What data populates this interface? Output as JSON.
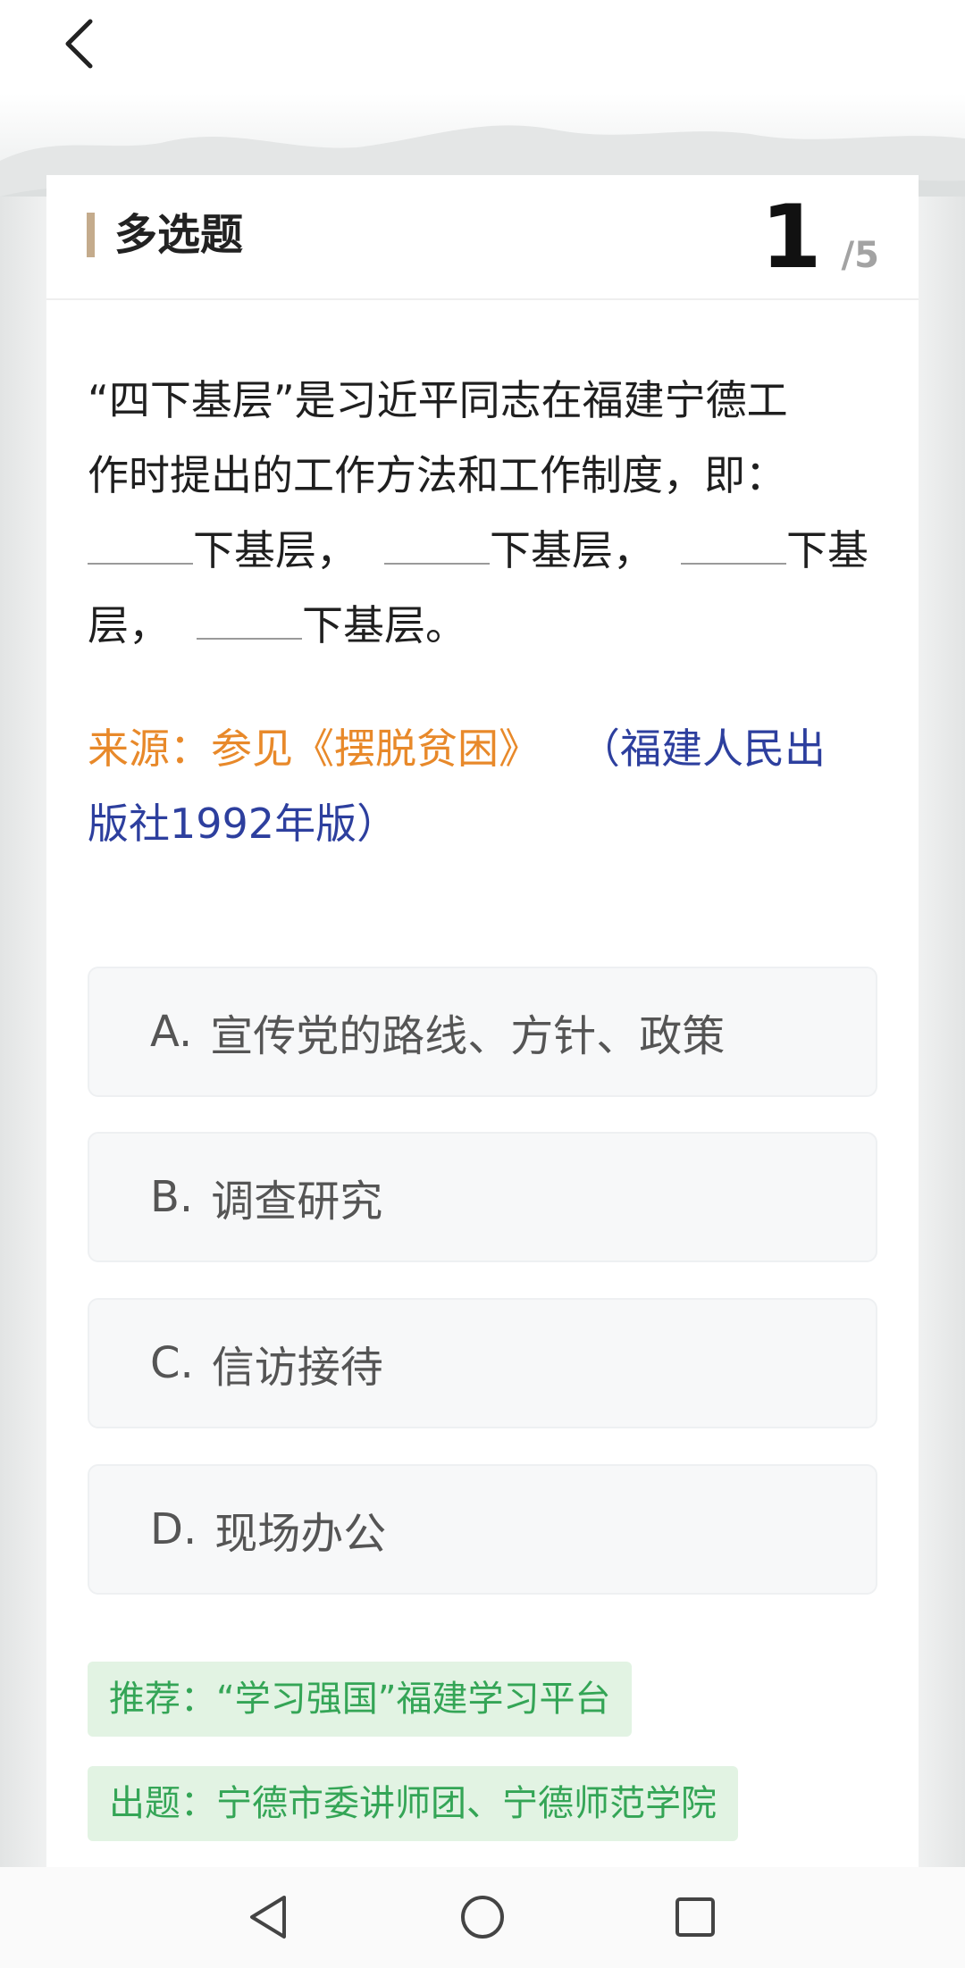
{
  "header": {
    "back_icon": "chevron-left-icon"
  },
  "card": {
    "type_label": "多选题",
    "counter_current": "1",
    "counter_total": "/5"
  },
  "question": {
    "lines": [
      "“四下基层”是习近平同志在福建宁德工",
      "作时提出的工作方法和工作制度，即：",
      "下基层，",
      "下基层，",
      "下基",
      "层，",
      "下基层。"
    ]
  },
  "source": {
    "label": "来源：参见《摆脱贫困》",
    "extra_line1": "（福建人民出",
    "extra_line2": "版社1992年版）"
  },
  "options": [
    {
      "key": "A.",
      "text": "宣传党的路线、方针、政策"
    },
    {
      "key": "B.",
      "text": "调查研究"
    },
    {
      "key": "C.",
      "text": "信访接待"
    },
    {
      "key": "D.",
      "text": "现场办公"
    }
  ],
  "tags": {
    "recommend": "推荐：“学习强国”福建学习平台",
    "author": "出题：宁德市委讲师团、宁德师范学院"
  },
  "colors": {
    "accent_bar": "#c4ab8c",
    "source_label": "#e8892a",
    "source_extra": "#2d3f9e",
    "tag_text": "#34a556",
    "tag_bg": "#e2f3e3"
  },
  "navbar": {
    "icons": [
      "back-triangle-icon",
      "home-circle-icon",
      "recents-square-icon"
    ]
  }
}
